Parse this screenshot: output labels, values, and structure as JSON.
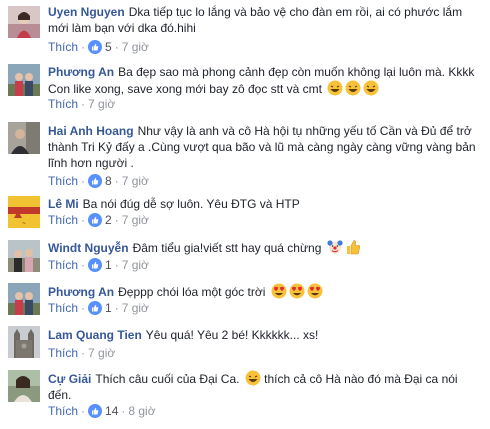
{
  "comments": [
    {
      "author": "Uyen Nguyen",
      "text": "Dka tiếp tục lo lắng và bảo vệ cho đàn em rồi, ai có phước lắm mới làm bạn với dka đó.hihi",
      "like_label": "Thích",
      "likes": "5",
      "time": "7 giờ"
    },
    {
      "author": "Phương An",
      "text": "Ba đẹp sao mà phong cảnh đẹp còn muốn không lại luôn mà. Kkkk Con like xong, save xong mới bay zô đọc stt và cmt",
      "like_label": "Thích",
      "time": "7 giờ"
    },
    {
      "author": "Hai Anh Hoang",
      "text": "Như vậy là anh và cô Hà hội tụ những yếu tố Cần và Đủ để trở thành Tri Kỷ đấy a .Cùng vượt qua bão và lũ mà càng ngày càng vững vàng bản lĩnh hơn người .",
      "like_label": "Thích",
      "likes": "8",
      "time": "7 giờ"
    },
    {
      "author": "Lê Mi",
      "text": "Ba nói đúg dễ sợ luôn. Yêu ĐTG và HTP",
      "like_label": "Thích",
      "likes": "2",
      "time": "7 giờ"
    },
    {
      "author": "Windt Nguyễn",
      "text": "Đâm tiểu gia!viết stt hay quá chừng",
      "like_label": "Thích",
      "likes": "1",
      "time": "7 giờ"
    },
    {
      "author": "Phương An",
      "text": "Đẹppp chói lóa một góc trời",
      "like_label": "Thích",
      "likes": "1",
      "time": "7 giờ"
    },
    {
      "author": "Lam Quang Tien",
      "text": "Yêu quá! Yêu 2 bé! Kkkkkk... xs!",
      "like_label": "Thích",
      "time": "7 giờ"
    },
    {
      "author": "Cự Giải",
      "text": "Thích câu cuối của Đại Ca.",
      "text_after": "thích cả cô Hà nào đó mà Đại ca nói đến.",
      "like_label": "Thích",
      "likes": "14",
      "time": "8 giờ"
    }
  ],
  "colors": {
    "author": "#365899",
    "like": "#4267b2",
    "meta": "#90949c",
    "badge": "#5890ff"
  },
  "icons": {
    "reaction_badge": "thumbs-up-icon",
    "laughing": "laughing-emoji-icon",
    "heart_eyes": "heart-eyes-emoji-icon",
    "clown": "clown-emoji-icon",
    "thumbs_up": "thumbs-up-emoji-icon"
  }
}
